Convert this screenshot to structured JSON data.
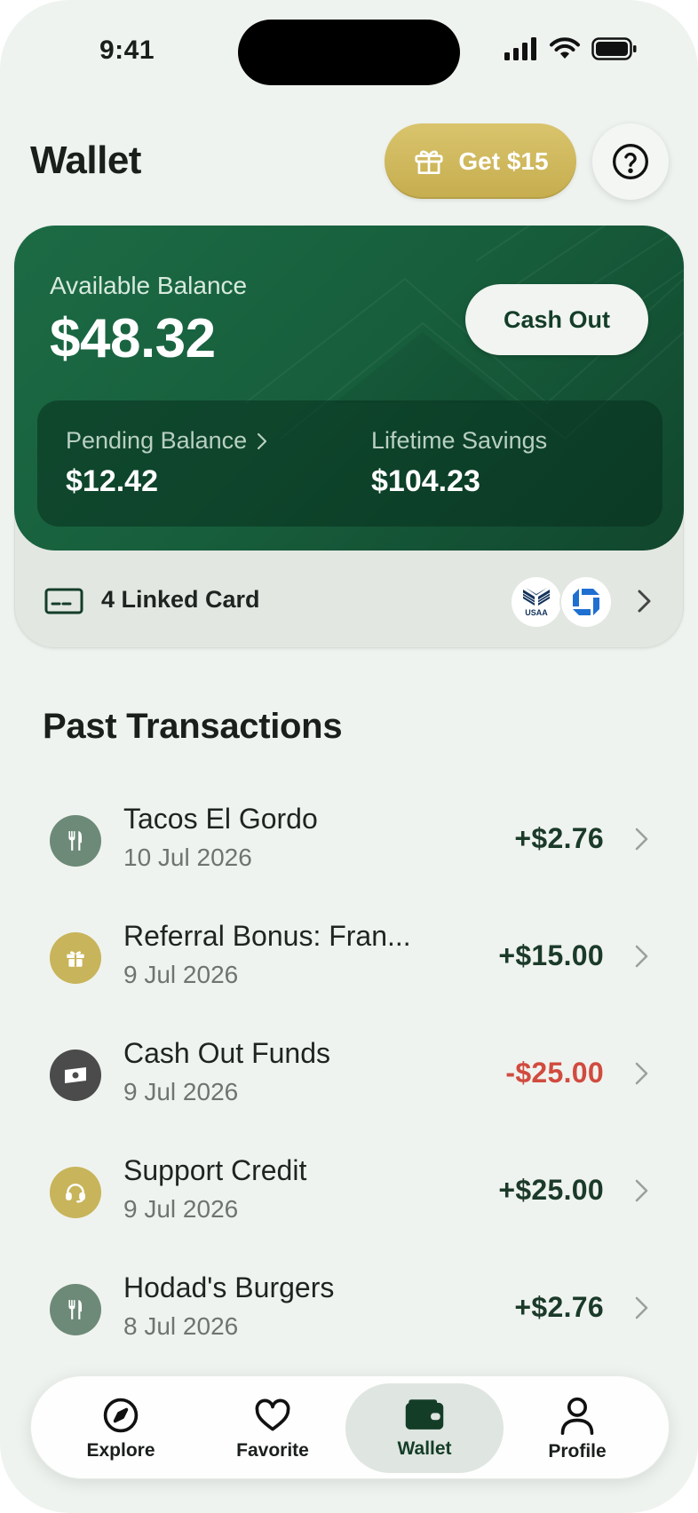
{
  "status_bar": {
    "time": "9:41"
  },
  "header": {
    "title": "Wallet",
    "promo_label": "Get $15"
  },
  "balance": {
    "available_label": "Available Balance",
    "available_amount": "$48.32",
    "cash_out_label": "Cash Out",
    "pending_label": "Pending Balance",
    "pending_amount": "$12.42",
    "lifetime_label": "Lifetime Savings",
    "lifetime_amount": "$104.23"
  },
  "linked_cards": {
    "label": "4 Linked Card",
    "banks": [
      "USAA",
      "Chase"
    ]
  },
  "transactions": {
    "title": "Past Transactions",
    "items": [
      {
        "name": "Tacos El Gordo",
        "date": "10 Jul 2026",
        "amount": "+$2.76",
        "icon": "fork-knife-icon",
        "color": "#6d8a78"
      },
      {
        "name": "Referral Bonus: Fran...",
        "date": "9 Jul 2026",
        "amount": "+$15.00",
        "icon": "gift-icon",
        "color": "#c8b45a"
      },
      {
        "name": "Cash Out Funds",
        "date": "9 Jul 2026",
        "amount": "-$25.00",
        "icon": "cash-icon",
        "color": "#4b4b4b"
      },
      {
        "name": "Support Credit",
        "date": "9 Jul 2026",
        "amount": "+$25.00",
        "icon": "headset-icon",
        "color": "#c8b45a"
      },
      {
        "name": "Hodad's Burgers",
        "date": "8 Jul 2026",
        "amount": "+$2.76",
        "icon": "fork-knife-icon",
        "color": "#6d8a78"
      }
    ]
  },
  "tabbar": {
    "active": "Wallet",
    "items": [
      {
        "label": "Explore",
        "icon": "compass-icon"
      },
      {
        "label": "Favorite",
        "icon": "heart-icon"
      },
      {
        "label": "Wallet",
        "icon": "wallet-icon"
      },
      {
        "label": "Profile",
        "icon": "person-icon"
      }
    ]
  },
  "colors": {
    "brand_green": "#1c6b45",
    "gold": "#c8b45a",
    "negative": "#d14b3f"
  }
}
